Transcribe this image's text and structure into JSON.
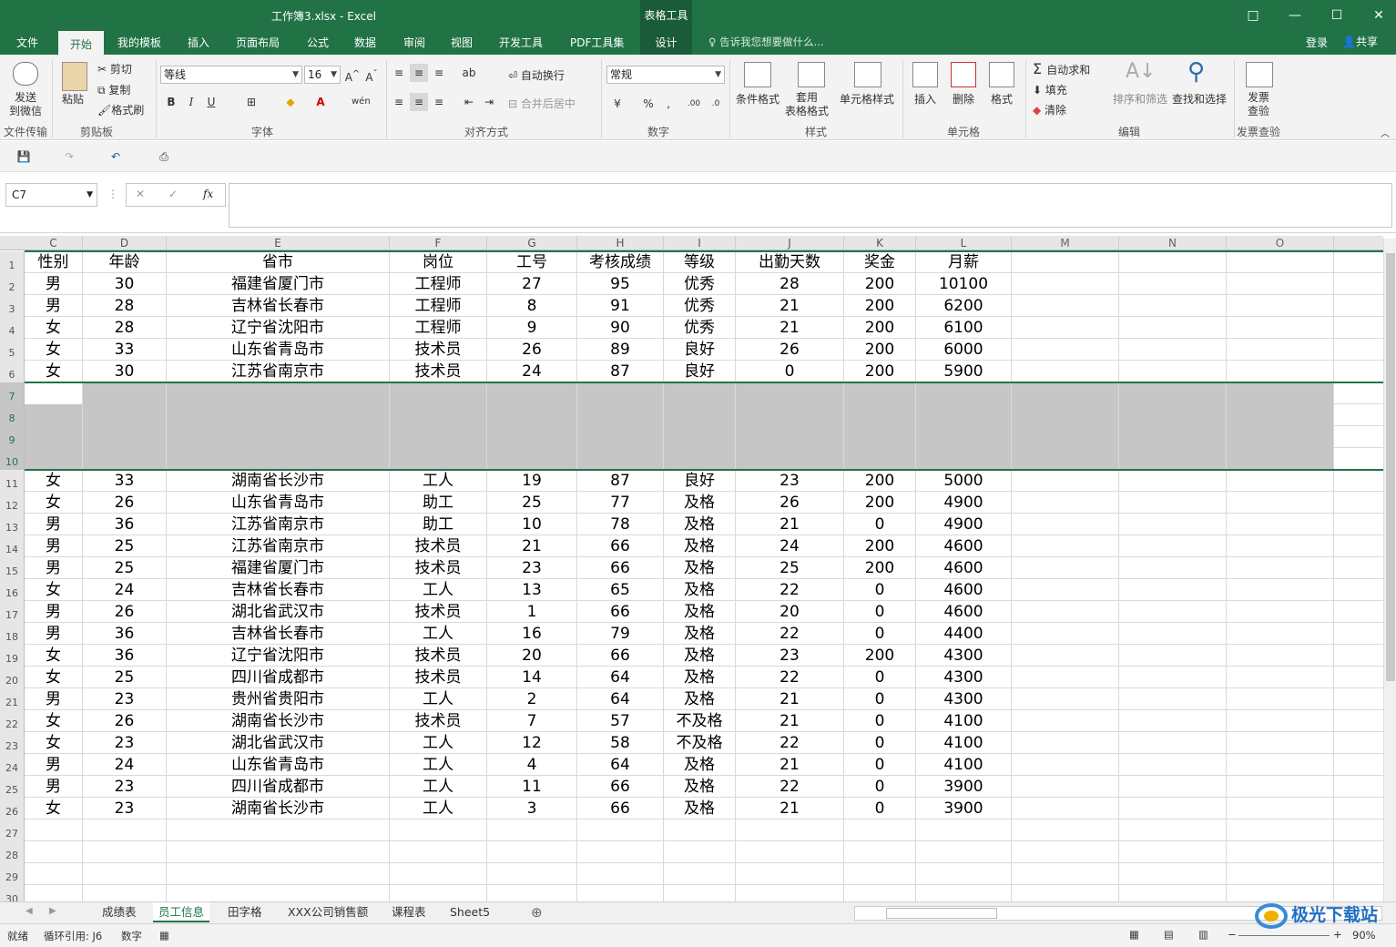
{
  "app": {
    "doc_title": "工作簿3.xlsx - Excel",
    "context_group": "表格工具",
    "window_buttons": [
      "□",
      "—",
      "☐",
      "✕"
    ]
  },
  "menu": {
    "tabs": [
      "文件",
      "开始",
      "我的模板",
      "插入",
      "页面布局",
      "公式",
      "数据",
      "审阅",
      "视图",
      "开发工具",
      "PDF工具集",
      "设计"
    ],
    "tell_me": "告诉我您想要做什么...",
    "login": "登录",
    "share": "共享"
  },
  "ribbon": {
    "send_wechat": "发送\n到微信",
    "paste": "粘贴",
    "cut": "剪切",
    "copy": "复制",
    "format_painter": "格式刷",
    "font_name": "等线",
    "font_size": "16",
    "wrap_text": "自动换行",
    "merge_center": "合并后居中",
    "number_format": "常规",
    "cond_format": "条件格式",
    "table_format": "套用\n表格格式",
    "cell_styles": "单元格样式",
    "insert": "插入",
    "delete": "删除",
    "format": "格式",
    "autosum": "自动求和",
    "fill": "填充",
    "clear": "清除",
    "sort_filter": "排序和筛选",
    "find_select": "查找和选择",
    "invoice_check": "发票\n查验",
    "group_labels": [
      "文件传输",
      "剪贴板",
      "字体",
      "对齐方式",
      "数字",
      "样式",
      "单元格",
      "编辑",
      "发票查验"
    ]
  },
  "formula_bar": {
    "name_box": "C7",
    "fx": "fx",
    "formula": ""
  },
  "columns": [
    "C",
    "D",
    "E",
    "F",
    "G",
    "H",
    "I",
    "J",
    "K",
    "L",
    "M",
    "N",
    "O"
  ],
  "header_row": [
    "性别",
    "年龄",
    "省市",
    "岗位",
    "工号",
    "考核成绩",
    "等级",
    "出勤天数",
    "奖金",
    "月薪"
  ],
  "rows": [
    {
      "n": "2",
      "cells": [
        "男",
        "30",
        "福建省厦门市",
        "工程师",
        "27",
        "95",
        "优秀",
        "28",
        "200",
        "10100"
      ]
    },
    {
      "n": "3",
      "cells": [
        "男",
        "28",
        "吉林省长春市",
        "工程师",
        "8",
        "91",
        "优秀",
        "21",
        "200",
        "6200"
      ]
    },
    {
      "n": "4",
      "cells": [
        "女",
        "28",
        "辽宁省沈阳市",
        "工程师",
        "9",
        "90",
        "优秀",
        "21",
        "200",
        "6100"
      ]
    },
    {
      "n": "5",
      "cells": [
        "女",
        "33",
        "山东省青岛市",
        "技术员",
        "26",
        "89",
        "良好",
        "26",
        "200",
        "6000"
      ]
    },
    {
      "n": "6",
      "cells": [
        "女",
        "30",
        "江苏省南京市",
        "技术员",
        "24",
        "87",
        "良好",
        "0",
        "200",
        "5900"
      ]
    },
    {
      "n": "7",
      "cells": [
        "",
        "",
        "",
        "",
        "",
        "",
        "",
        "",
        "",
        ""
      ]
    },
    {
      "n": "8",
      "cells": [
        "",
        "",
        "",
        "",
        "",
        "",
        "",
        "",
        "",
        ""
      ]
    },
    {
      "n": "9",
      "cells": [
        "",
        "",
        "",
        "",
        "",
        "",
        "",
        "",
        "",
        ""
      ]
    },
    {
      "n": "10",
      "cells": [
        "",
        "",
        "",
        "",
        "",
        "",
        "",
        "",
        "",
        ""
      ]
    },
    {
      "n": "11",
      "cells": [
        "女",
        "33",
        "湖南省长沙市",
        "工人",
        "19",
        "87",
        "良好",
        "23",
        "200",
        "5000"
      ]
    },
    {
      "n": "12",
      "cells": [
        "女",
        "26",
        "山东省青岛市",
        "助工",
        "25",
        "77",
        "及格",
        "26",
        "200",
        "4900"
      ]
    },
    {
      "n": "13",
      "cells": [
        "男",
        "36",
        "江苏省南京市",
        "助工",
        "10",
        "78",
        "及格",
        "21",
        "0",
        "4900"
      ]
    },
    {
      "n": "14",
      "cells": [
        "男",
        "25",
        "江苏省南京市",
        "技术员",
        "21",
        "66",
        "及格",
        "24",
        "200",
        "4600"
      ]
    },
    {
      "n": "15",
      "cells": [
        "男",
        "25",
        "福建省厦门市",
        "技术员",
        "23",
        "66",
        "及格",
        "25",
        "200",
        "4600"
      ]
    },
    {
      "n": "16",
      "cells": [
        "女",
        "24",
        "吉林省长春市",
        "工人",
        "13",
        "65",
        "及格",
        "22",
        "0",
        "4600"
      ]
    },
    {
      "n": "17",
      "cells": [
        "男",
        "26",
        "湖北省武汉市",
        "技术员",
        "1",
        "66",
        "及格",
        "20",
        "0",
        "4600"
      ]
    },
    {
      "n": "18",
      "cells": [
        "男",
        "36",
        "吉林省长春市",
        "工人",
        "16",
        "79",
        "及格",
        "22",
        "0",
        "4400"
      ]
    },
    {
      "n": "19",
      "cells": [
        "女",
        "36",
        "辽宁省沈阳市",
        "技术员",
        "20",
        "66",
        "及格",
        "23",
        "200",
        "4300"
      ]
    },
    {
      "n": "20",
      "cells": [
        "女",
        "25",
        "四川省成都市",
        "技术员",
        "14",
        "64",
        "及格",
        "22",
        "0",
        "4300"
      ]
    },
    {
      "n": "21",
      "cells": [
        "男",
        "23",
        "贵州省贵阳市",
        "工人",
        "2",
        "64",
        "及格",
        "21",
        "0",
        "4300"
      ]
    },
    {
      "n": "22",
      "cells": [
        "女",
        "26",
        "湖南省长沙市",
        "技术员",
        "7",
        "57",
        "不及格",
        "21",
        "0",
        "4100"
      ]
    },
    {
      "n": "23",
      "cells": [
        "女",
        "23",
        "湖北省武汉市",
        "工人",
        "12",
        "58",
        "不及格",
        "22",
        "0",
        "4100"
      ]
    },
    {
      "n": "24",
      "cells": [
        "男",
        "24",
        "山东省青岛市",
        "工人",
        "4",
        "64",
        "及格",
        "21",
        "0",
        "4100"
      ]
    },
    {
      "n": "25",
      "cells": [
        "男",
        "23",
        "四川省成都市",
        "工人",
        "11",
        "66",
        "及格",
        "22",
        "0",
        "3900"
      ]
    },
    {
      "n": "26",
      "cells": [
        "女",
        "23",
        "湖南省长沙市",
        "工人",
        "3",
        "66",
        "及格",
        "21",
        "0",
        "3900"
      ]
    },
    {
      "n": "27",
      "cells": [
        "",
        "",
        "",
        "",
        "",
        "",
        "",
        "",
        "",
        ""
      ]
    },
    {
      "n": "28",
      "cells": [
        "",
        "",
        "",
        "",
        "",
        "",
        "",
        "",
        "",
        ""
      ]
    },
    {
      "n": "29",
      "cells": [
        "",
        "",
        "",
        "",
        "",
        "",
        "",
        "",
        "",
        ""
      ]
    },
    {
      "n": "30",
      "cells": [
        "",
        "",
        "",
        "",
        "",
        "",
        "",
        "",
        "",
        ""
      ]
    }
  ],
  "sheets": [
    "成绩表",
    "员工信息",
    "田字格",
    "XXX公司销售额",
    "课程表",
    "Sheet5"
  ],
  "active_sheet": "员工信息",
  "status": {
    "ready": "就绪",
    "circular": "循环引用: J6",
    "numeric": "数字",
    "zoom": "90%"
  },
  "watermark": "极光下载站",
  "colors": {
    "accent": "#217346",
    "selection": "#c6c6c6"
  }
}
